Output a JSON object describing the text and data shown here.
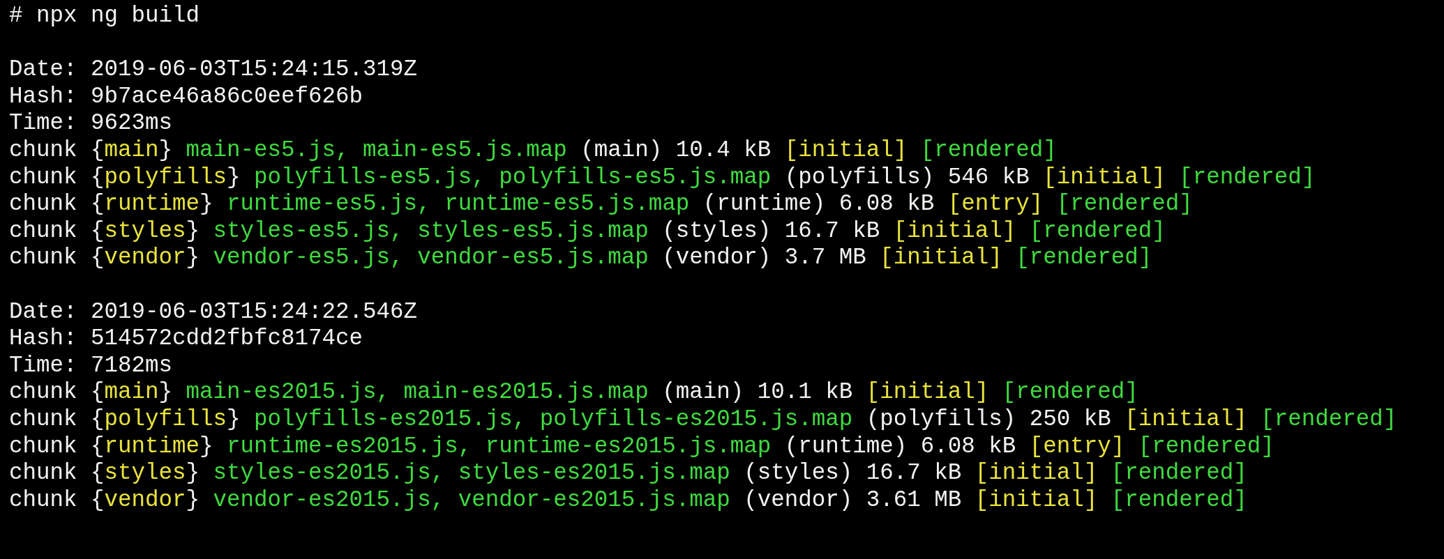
{
  "command": [
    {
      "text": "# npx ng build",
      "color": "#f2f2f2"
    }
  ],
  "builds": [
    {
      "lines": [
        [
          {
            "text": "Date: 2019-06-03T15:24:15.319Z",
            "color": "#f2f2f2"
          }
        ],
        [
          {
            "text": "Hash: 9b7ace46a86c0eef626b",
            "color": "#f2f2f2"
          }
        ],
        [
          {
            "text": "Time: 9623ms",
            "color": "#f2f2f2"
          }
        ],
        [
          {
            "text": "chunk {",
            "color": "#f2f2f2"
          },
          {
            "text": "main",
            "color": "#e9e33c"
          },
          {
            "text": "} ",
            "color": "#f2f2f2"
          },
          {
            "text": "main-es5.js, main-es5.js.map",
            "color": "#3fdb3f"
          },
          {
            "text": " (main) 10.4 kB ",
            "color": "#f2f2f2"
          },
          {
            "text": "[initial] ",
            "color": "#e9e33c"
          },
          {
            "text": "[rendered]",
            "color": "#3fdb3f"
          }
        ],
        [
          {
            "text": "chunk {",
            "color": "#f2f2f2"
          },
          {
            "text": "polyfills",
            "color": "#e9e33c"
          },
          {
            "text": "} ",
            "color": "#f2f2f2"
          },
          {
            "text": "polyfills-es5.js, polyfills-es5.js.map",
            "color": "#3fdb3f"
          },
          {
            "text": " (polyfills) 546 kB ",
            "color": "#f2f2f2"
          },
          {
            "text": "[initial] ",
            "color": "#e9e33c"
          },
          {
            "text": "[rendered]",
            "color": "#3fdb3f"
          }
        ],
        [
          {
            "text": "chunk {",
            "color": "#f2f2f2"
          },
          {
            "text": "runtime",
            "color": "#e9e33c"
          },
          {
            "text": "} ",
            "color": "#f2f2f2"
          },
          {
            "text": "runtime-es5.js, runtime-es5.js.map",
            "color": "#3fdb3f"
          },
          {
            "text": " (runtime) 6.08 kB ",
            "color": "#f2f2f2"
          },
          {
            "text": "[entry] ",
            "color": "#e9e33c"
          },
          {
            "text": "[rendered]",
            "color": "#3fdb3f"
          }
        ],
        [
          {
            "text": "chunk {",
            "color": "#f2f2f2"
          },
          {
            "text": "styles",
            "color": "#e9e33c"
          },
          {
            "text": "} ",
            "color": "#f2f2f2"
          },
          {
            "text": "styles-es5.js, styles-es5.js.map",
            "color": "#3fdb3f"
          },
          {
            "text": " (styles) 16.7 kB ",
            "color": "#f2f2f2"
          },
          {
            "text": "[initial] ",
            "color": "#e9e33c"
          },
          {
            "text": "[rendered]",
            "color": "#3fdb3f"
          }
        ],
        [
          {
            "text": "chunk {",
            "color": "#f2f2f2"
          },
          {
            "text": "vendor",
            "color": "#e9e33c"
          },
          {
            "text": "} ",
            "color": "#f2f2f2"
          },
          {
            "text": "vendor-es5.js, vendor-es5.js.map",
            "color": "#3fdb3f"
          },
          {
            "text": " (vendor) 3.7 MB ",
            "color": "#f2f2f2"
          },
          {
            "text": "[initial] ",
            "color": "#e9e33c"
          },
          {
            "text": "[rendered]",
            "color": "#3fdb3f"
          }
        ]
      ]
    },
    {
      "lines": [
        [
          {
            "text": "Date: 2019-06-03T15:24:22.546Z",
            "color": "#f2f2f2"
          }
        ],
        [
          {
            "text": "Hash: 514572cdd2fbfc8174ce",
            "color": "#f2f2f2"
          }
        ],
        [
          {
            "text": "Time: 7182ms",
            "color": "#f2f2f2"
          }
        ],
        [
          {
            "text": "chunk {",
            "color": "#f2f2f2"
          },
          {
            "text": "main",
            "color": "#e9e33c"
          },
          {
            "text": "} ",
            "color": "#f2f2f2"
          },
          {
            "text": "main-es2015.js, main-es2015.js.map",
            "color": "#3fdb3f"
          },
          {
            "text": " (main) 10.1 kB ",
            "color": "#f2f2f2"
          },
          {
            "text": "[initial] ",
            "color": "#e9e33c"
          },
          {
            "text": "[rendered]",
            "color": "#3fdb3f"
          }
        ],
        [
          {
            "text": "chunk {",
            "color": "#f2f2f2"
          },
          {
            "text": "polyfills",
            "color": "#e9e33c"
          },
          {
            "text": "} ",
            "color": "#f2f2f2"
          },
          {
            "text": "polyfills-es2015.js, polyfills-es2015.js.map",
            "color": "#3fdb3f"
          },
          {
            "text": " (polyfills) 250 kB ",
            "color": "#f2f2f2"
          },
          {
            "text": "[initial] ",
            "color": "#e9e33c"
          },
          {
            "text": "[rendered]",
            "color": "#3fdb3f"
          }
        ],
        [
          {
            "text": "chunk {",
            "color": "#f2f2f2"
          },
          {
            "text": "runtime",
            "color": "#e9e33c"
          },
          {
            "text": "} ",
            "color": "#f2f2f2"
          },
          {
            "text": "runtime-es2015.js, runtime-es2015.js.map",
            "color": "#3fdb3f"
          },
          {
            "text": " (runtime) 6.08 kB ",
            "color": "#f2f2f2"
          },
          {
            "text": "[entry] ",
            "color": "#e9e33c"
          },
          {
            "text": "[rendered]",
            "color": "#3fdb3f"
          }
        ],
        [
          {
            "text": "chunk {",
            "color": "#f2f2f2"
          },
          {
            "text": "styles",
            "color": "#e9e33c"
          },
          {
            "text": "} ",
            "color": "#f2f2f2"
          },
          {
            "text": "styles-es2015.js, styles-es2015.js.map",
            "color": "#3fdb3f"
          },
          {
            "text": " (styles) 16.7 kB ",
            "color": "#f2f2f2"
          },
          {
            "text": "[initial] ",
            "color": "#e9e33c"
          },
          {
            "text": "[rendered]",
            "color": "#3fdb3f"
          }
        ],
        [
          {
            "text": "chunk {",
            "color": "#f2f2f2"
          },
          {
            "text": "vendor",
            "color": "#e9e33c"
          },
          {
            "text": "} ",
            "color": "#f2f2f2"
          },
          {
            "text": "vendor-es2015.js, vendor-es2015.js.map",
            "color": "#3fdb3f"
          },
          {
            "text": " (vendor) 3.61 MB ",
            "color": "#f2f2f2"
          },
          {
            "text": "[initial] ",
            "color": "#e9e33c"
          },
          {
            "text": "[rendered]",
            "color": "#3fdb3f"
          }
        ]
      ]
    }
  ]
}
